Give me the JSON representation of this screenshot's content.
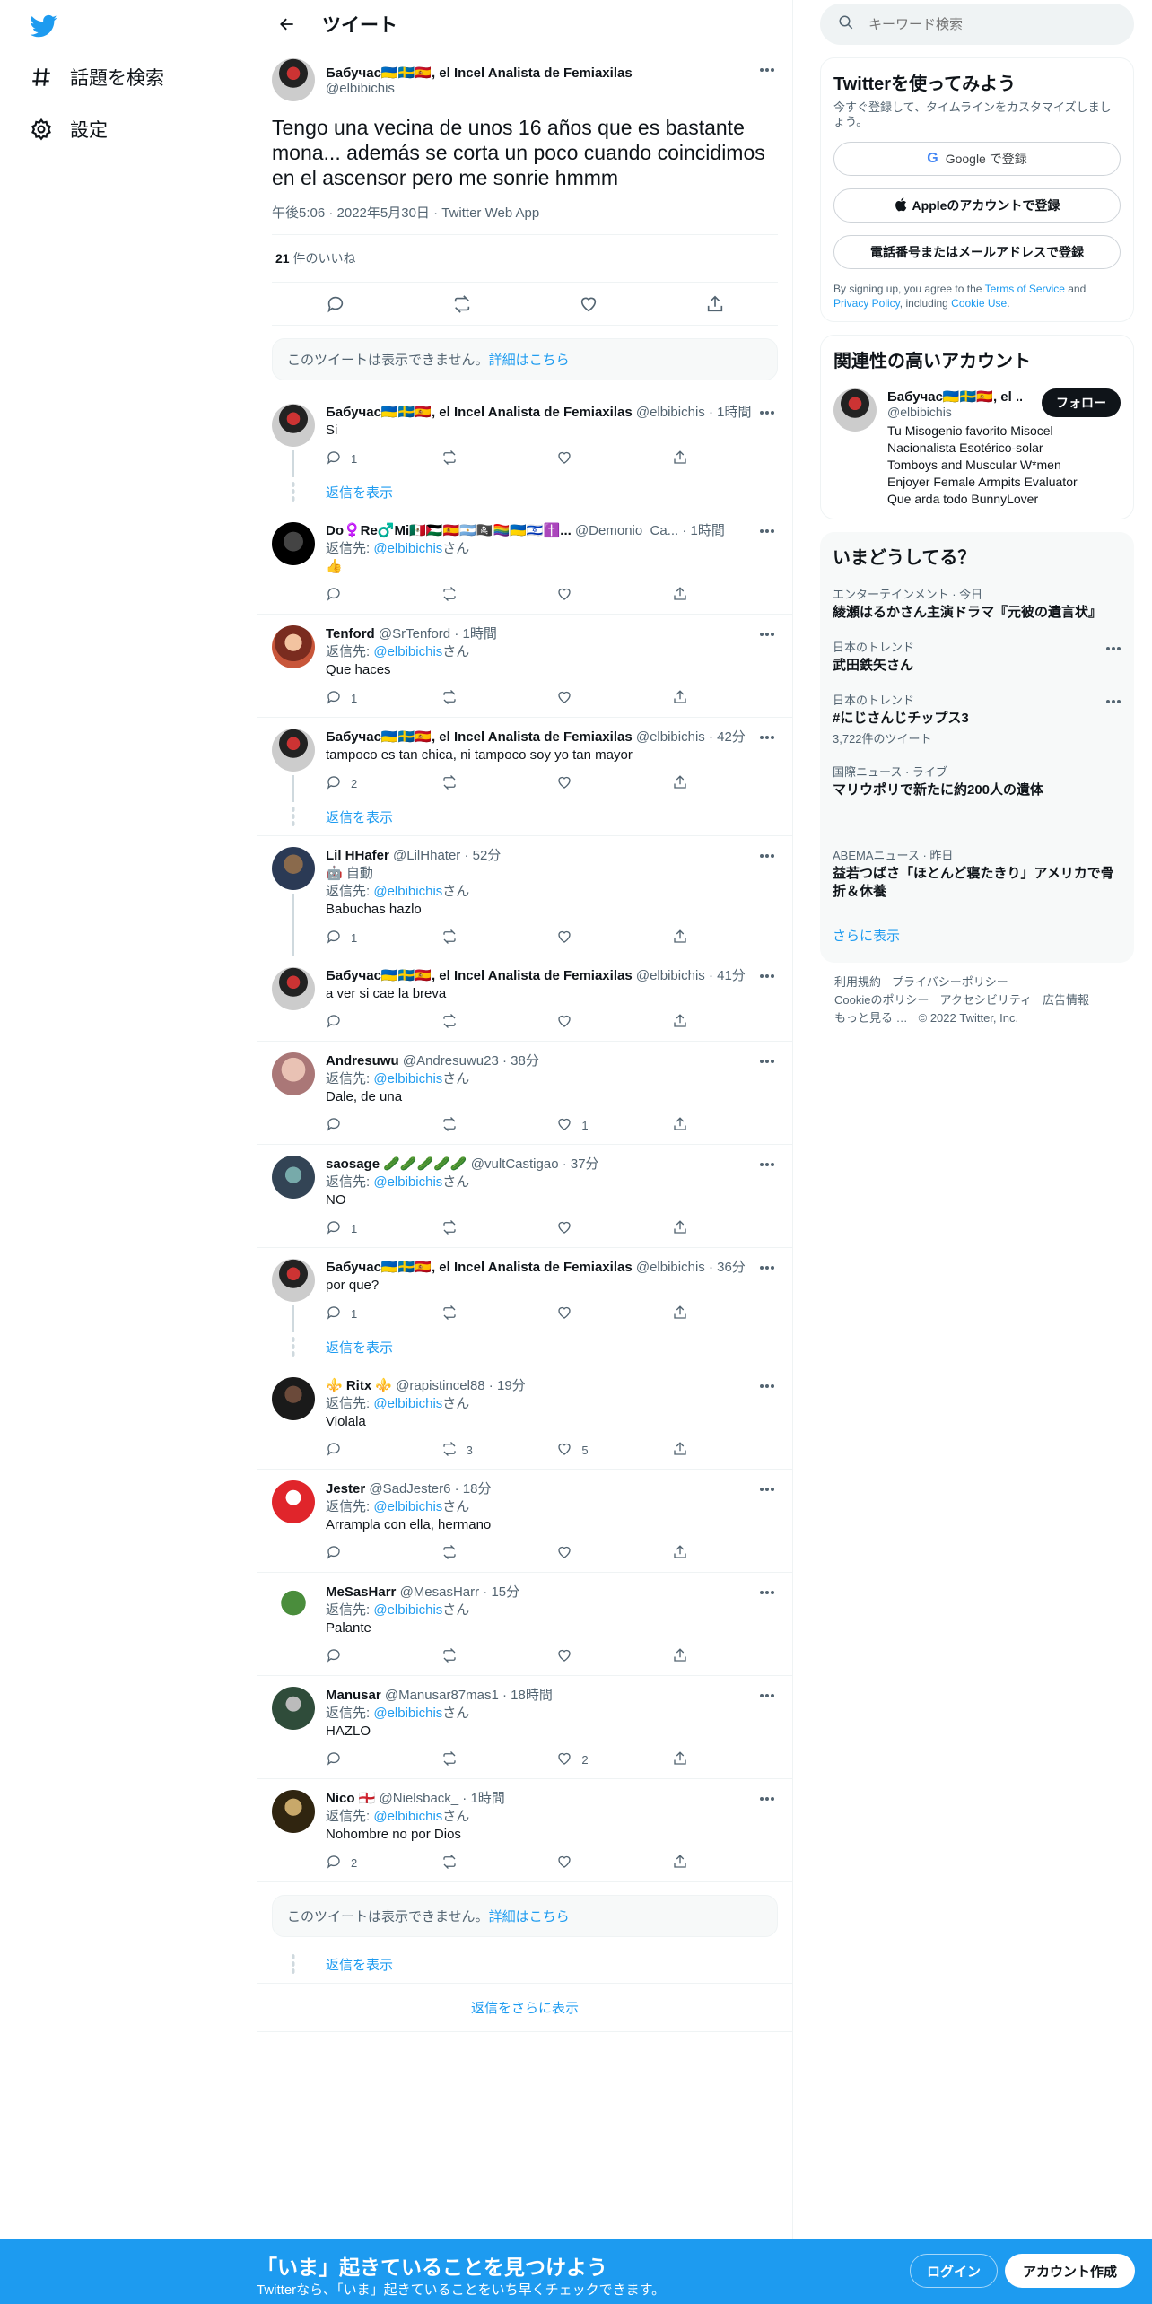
{
  "nav": {
    "explore": "話題を検索",
    "settings": "設定"
  },
  "header": {
    "title": "ツイート"
  },
  "focal": {
    "name": "Бабучас🇺🇦🇸🇪🇪🇸, el Incel Analista de Femiaxilas",
    "handle": "@elbibichis",
    "text": "Tengo una vecina de unos 16 años que es bastante mona... además se corta un poco cuando coincidimos en el ascensor pero me sonrie hmmm",
    "meta": "午後5:06 · 2022年5月30日 · Twitter Web App",
    "likes_count": "21",
    "likes_label": " 件のいいね"
  },
  "unavailable": {
    "text": "このツイートは表示できません。",
    "link": "詳細はこちら"
  },
  "tweets": [
    {
      "name": "Бабучас🇺🇦🇸🇪🇪🇸, el Incel Analista de Femiaxilas",
      "handle": "@elbibichis · 1時間",
      "reply_to": "",
      "text": "Si",
      "replies": "1",
      "retweets": "",
      "likes": ""
    },
    {
      "name": "Do♀️Re♂️Mi🇲🇽🇵🇸🇪🇸🇦🇷🏴‍☠️🏳️‍🌈🇺🇦🇮🇱✝️...",
      "handle": "@Demonio_Ca... · 1時間",
      "reply_to": "@elbibichis",
      "text": "👍",
      "replies": "",
      "retweets": "",
      "likes": ""
    },
    {
      "name": "Tenford",
      "handle": "@SrTenford · 1時間",
      "reply_to": "@elbibichis",
      "text": "Que haces",
      "replies": "1",
      "retweets": "",
      "likes": ""
    },
    {
      "name": "Бабучас🇺🇦🇸🇪🇪🇸, el Incel Analista de Femiaxilas",
      "handle": "@elbibichis · 42分",
      "reply_to": "",
      "text": "tampoco es tan chica, ni tampoco soy yo tan mayor",
      "replies": "2",
      "retweets": "",
      "likes": ""
    },
    {
      "name": "Lil HHafer",
      "handle": "@LilHhater · 52分",
      "auto": "🤖 自動",
      "reply_to": "@elbibichis",
      "text": "Babuchas hazlo",
      "replies": "1",
      "retweets": "",
      "likes": ""
    },
    {
      "name": "Бабучас🇺🇦🇸🇪🇪🇸, el Incel Analista de Femiaxilas",
      "handle": "@elbibichis · 41分",
      "reply_to": "",
      "text": "a ver si cae la breva",
      "replies": "",
      "retweets": "",
      "likes": ""
    },
    {
      "name": "Andresuwu",
      "handle": "@Andresuwu23 · 38分",
      "reply_to": "@elbibichis",
      "text": "Dale, de una",
      "replies": "",
      "retweets": "",
      "likes": "1"
    },
    {
      "name": "saosage 🥒🥒🥒🥒🥒",
      "handle": "@vultCastigao · 37分",
      "reply_to": "@elbibichis",
      "text": "NO",
      "replies": "1",
      "retweets": "",
      "likes": ""
    },
    {
      "name": "Бабучас🇺🇦🇸🇪🇪🇸, el Incel Analista de Femiaxilas",
      "handle": "@elbibichis · 36分",
      "reply_to": "",
      "text": "por que?",
      "replies": "1",
      "retweets": "",
      "likes": ""
    },
    {
      "name": "⚜️ Ritx ⚜️",
      "handle": "@rapistincel88 · 19分",
      "reply_to": "@elbibichis",
      "text": "Violala",
      "replies": "",
      "retweets": "3",
      "likes": "5"
    },
    {
      "name": "Jester",
      "handle": "@SadJester6 · 18分",
      "reply_to": "@elbibichis",
      "text": "Arrampla con ella, hermano",
      "replies": "",
      "retweets": "",
      "likes": ""
    },
    {
      "name": "MeSasHarr",
      "handle": "@MesasHarr · 15分",
      "reply_to": "@elbibichis",
      "text": "Palante",
      "replies": "",
      "retweets": "",
      "likes": ""
    },
    {
      "name": "Manusar",
      "handle": "@Manusar87mas1 · 18時間",
      "reply_to": "@elbibichis",
      "text": "HAZLO",
      "replies": "",
      "retweets": "",
      "likes": "2"
    },
    {
      "name": "Nico 🏴󠁧󠁢󠁥󠁮󠁧󠁿",
      "handle": "@Nielsback_ · 1時間",
      "reply_to": "@elbibichis",
      "text": "Nohombre no por Dios",
      "replies": "2",
      "retweets": "",
      "likes": ""
    }
  ],
  "reply_prefix": "返信先: ",
  "reply_suffix": "さん",
  "show_replies": "返信を表示",
  "more_replies": "返信をさらに表示",
  "sidebar": {
    "search_placeholder": "キーワード検索",
    "signup": {
      "title": "Twitterを使ってみよう",
      "subtitle": "今すぐ登録して、タイムラインをカスタマイズしましょう。",
      "google": "Google で登録",
      "apple": "Appleのアカウントで登録",
      "phone": "電話番号またはメールアドレスで登録",
      "terms_1": "By signing up, you agree to the ",
      "terms_tos": "Terms of Service",
      "terms_2": " and ",
      "terms_privacy": "Privacy Policy",
      "terms_3": ", including ",
      "terms_cookie": "Cookie Use",
      "terms_4": "."
    },
    "relevant": {
      "title": "関連性の高いアカウント",
      "name": "Бабучас🇺🇦🇸🇪🇪🇸, el ...",
      "handle": "@elbibichis",
      "bio": "Tu Misogenio favorito Misocel Nacionalista Esotérico-solar Tomboys and Muscular W*men Enjoyer Female Armpits Evaluator Que arda todo BunnyLover",
      "follow": "フォロー"
    },
    "trends": {
      "title": "いまどうしてる？",
      "items": [
        {
          "context": "エンターテインメント · 今日",
          "title": "綾瀬はるかさん主演ドラマ『元彼の遺言状』",
          "count": ""
        },
        {
          "context": "日本のトレンド",
          "title": "武田鉄矢さん",
          "count": ""
        },
        {
          "context": "日本のトレンド",
          "title": "#にじさんじチップス3",
          "count": "3,722件のツイート"
        },
        {
          "context": "国際ニュース · ライブ",
          "title": "マリウポリで新たに約200人の遺体",
          "count": ""
        },
        {
          "context": "ABEMAニュース · 昨日",
          "title": "益若つばさ「ほとんど寝たきり」アメリカで骨折＆休養",
          "count": ""
        }
      ],
      "show_more": "さらに表示"
    },
    "footer": [
      "利用規約",
      "プライバシーポリシー",
      "Cookieのポリシー",
      "アクセシビリティ",
      "広告情報",
      "もっと見る …",
      "© 2022 Twitter, Inc."
    ]
  },
  "banner": {
    "title": "「いま」起きていることを見つけよう",
    "subtitle": "Twitterなら、「いま」起きていることをいち早くチェックできます。",
    "login": "ログイン",
    "signup": "アカウント作成"
  },
  "colors": {
    "brand": "#1d9bf0",
    "text": "#0f1419",
    "muted": "#536471"
  }
}
